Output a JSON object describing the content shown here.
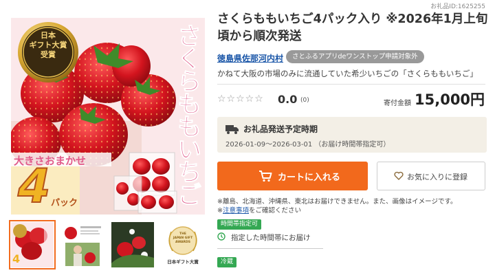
{
  "item_id": "お礼品ID:1625255",
  "title": "さくらももいちご4パック入り ※2026年1月上旬頃から順次発送",
  "municipality": "徳島県佐那河内村",
  "onestop_badge": "さとふるアプリdeワンストップ申請対象外",
  "description": "かねて大阪の市場のみに流通していた希少いちごの「さくらももいちご」",
  "rating": {
    "stars": "☆☆☆☆☆",
    "score": "0.0",
    "count": "(0)"
  },
  "price": {
    "label": "寄付金額",
    "value": "15,000円"
  },
  "shipping": {
    "title": "お礼品発送予定時期",
    "dates": "2026-01-09～2026-03-01 （お届け時間帯指定可）"
  },
  "buttons": {
    "cart": "カートに入れる",
    "favorite": "お気に入りに登録"
  },
  "notes": {
    "line1": "※離島、北海道、沖縄県、東北はお届けできません。また、画像はイメージです。",
    "line2_prefix": "※",
    "line2_link": "注意事項",
    "line2_suffix": "をご確認ください"
  },
  "tags": {
    "time_slot": "時間帯指定可",
    "chilled": "冷蔵"
  },
  "time_slot_text": "指定した時間帯にお届け",
  "main_image": {
    "award_line1": "日本",
    "award_line2": "ギフト大賞",
    "award_line3": "受賞",
    "vertical_text": "さくらももいちご",
    "banner": "大きさおまかせ",
    "big_number": "4",
    "pack_label": "パック"
  },
  "thumbnails": {
    "award_thumb_line1": "THE",
    "award_thumb_line2": "JAPAN GIFT",
    "award_thumb_line3": "AWARDS",
    "award_thumb_caption": "日本ギフト大賞",
    "thumb1_number": "4"
  },
  "colors": {
    "accent": "#f2691c",
    "link": "#1a56a8",
    "tag_green": "#34a853",
    "badge_gray": "#999999",
    "ship_bg": "#f3efe6"
  }
}
